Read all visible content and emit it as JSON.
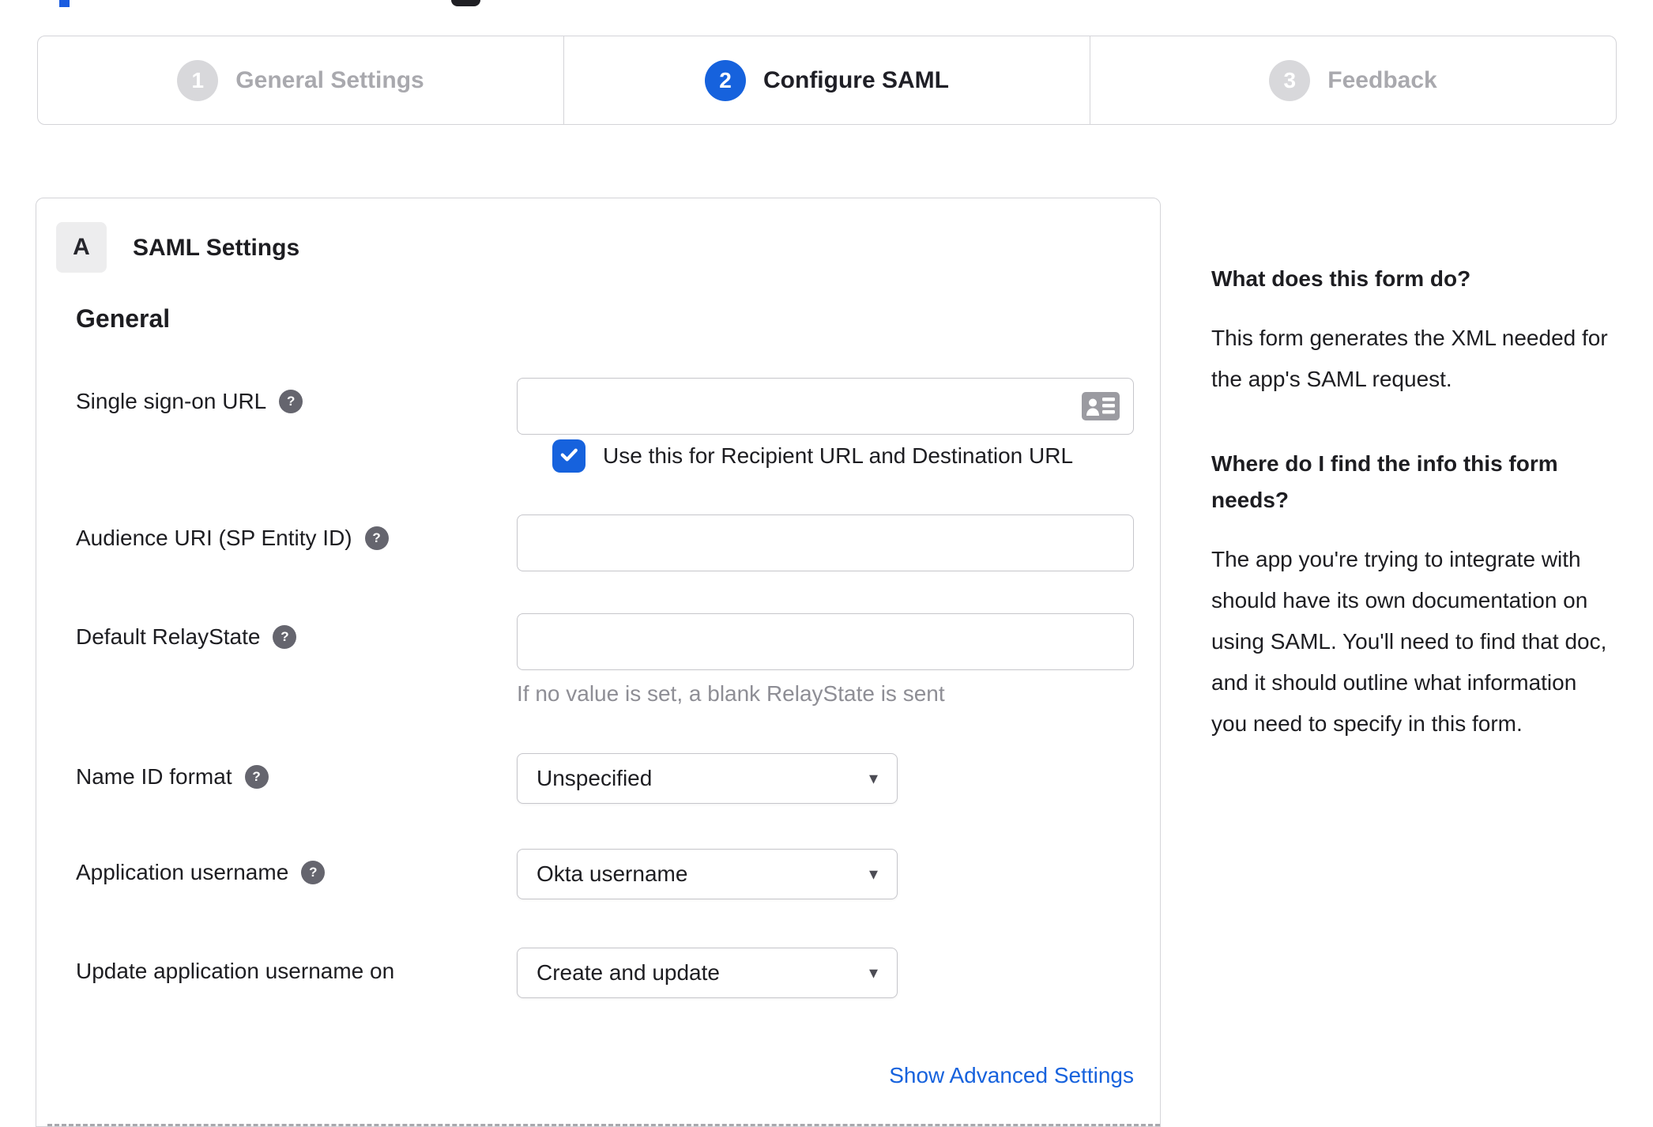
{
  "accent": "#1662dd",
  "glyphs": {
    "help": "?",
    "caret": "▾"
  },
  "stepper": {
    "steps": [
      {
        "number": "1",
        "label": "General Settings",
        "state": "inactive"
      },
      {
        "number": "2",
        "label": "Configure SAML",
        "state": "active"
      },
      {
        "number": "3",
        "label": "Feedback",
        "state": "inactive"
      }
    ]
  },
  "panel": {
    "section_letter": "A",
    "section_title": "SAML Settings",
    "group_title": "General",
    "fields": {
      "sso_url": {
        "label": "Single sign-on URL",
        "value": "",
        "checkbox_label": "Use this for Recipient URL and Destination URL",
        "checkbox_checked": true
      },
      "audience_uri": {
        "label": "Audience URI (SP Entity ID)",
        "value": ""
      },
      "relay_state": {
        "label": "Default RelayState",
        "value": "",
        "hint": "If no value is set, a blank RelayState is sent"
      },
      "name_id_format": {
        "label": "Name ID format",
        "value": "Unspecified"
      },
      "app_username": {
        "label": "Application username",
        "value": "Okta username"
      },
      "update_app_username": {
        "label": "Update application username on",
        "value": "Create and update"
      }
    },
    "advanced_link": "Show Advanced Settings"
  },
  "sidebar": {
    "sections": [
      {
        "heading": "What does this form do?",
        "body": "This form generates the XML needed for the app's SAML request."
      },
      {
        "heading": "Where do I find the info this form needs?",
        "body": "The app you're trying to integrate with should have its own documentation on using SAML. You'll need to find that doc, and it should outline what information you need to specify in this form."
      }
    ]
  }
}
